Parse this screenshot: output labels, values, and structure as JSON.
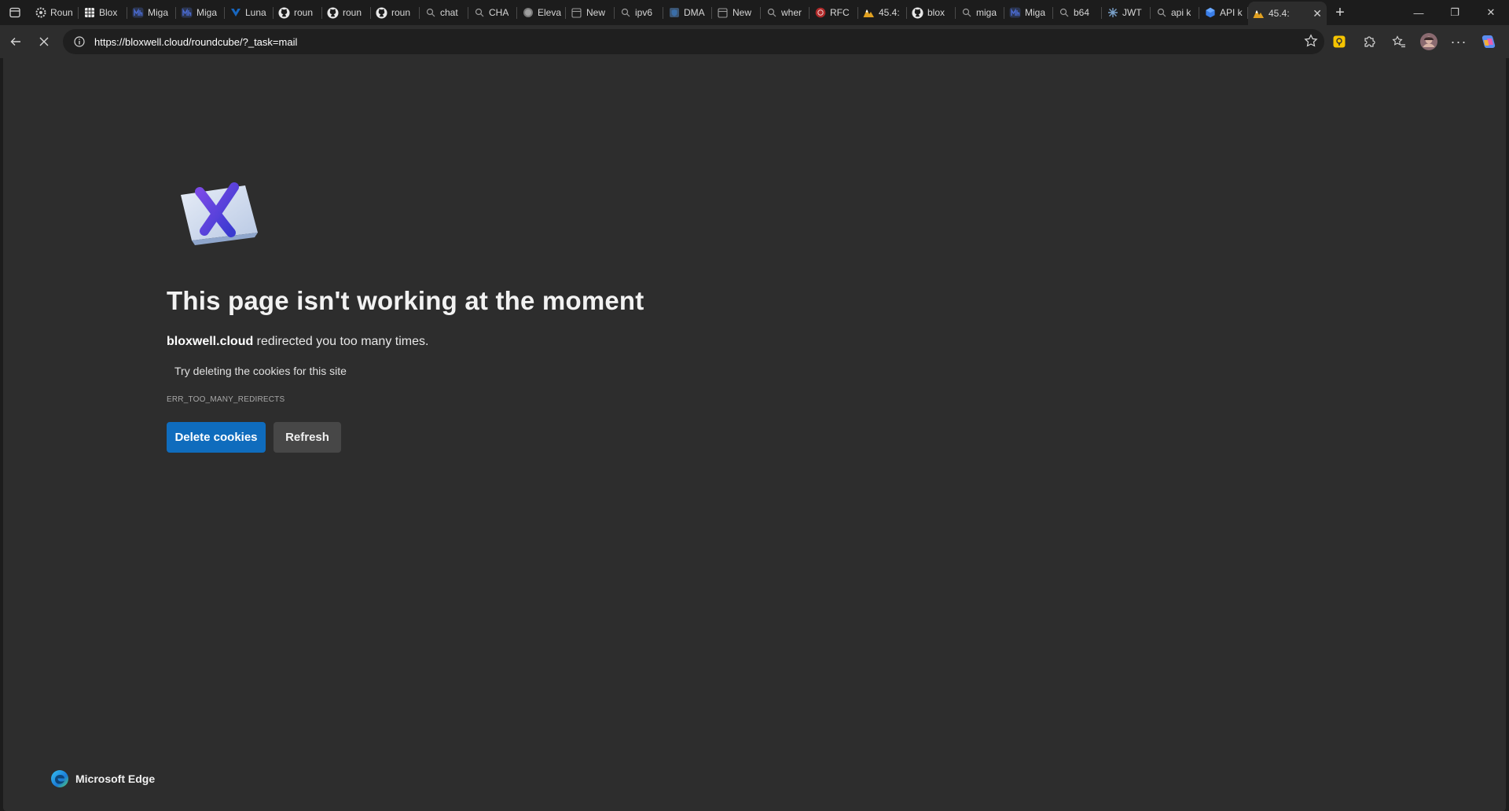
{
  "browser": {
    "tabs": [
      {
        "title": "Roun",
        "icon": "settings-gear-icon",
        "color": "#cfcfcf"
      },
      {
        "title": "Blox",
        "icon": "spreadsheet-icon",
        "color": "#e8e8e8"
      },
      {
        "title": "Miga",
        "icon": "mh-logo-icon",
        "color": "#4a6ad0"
      },
      {
        "title": "Miga",
        "icon": "mh-logo-icon",
        "color": "#4a6ad0"
      },
      {
        "title": "Luna",
        "icon": "vuetify-icon",
        "color": "#1867c0"
      },
      {
        "title": "roun",
        "icon": "github-icon",
        "color": "#e8e8e8"
      },
      {
        "title": "roun",
        "icon": "github-icon",
        "color": "#e8e8e8"
      },
      {
        "title": "roun",
        "icon": "github-icon",
        "color": "#e8e8e8"
      },
      {
        "title": "chat",
        "icon": "search-icon",
        "color": "#9a9a9a"
      },
      {
        "title": "CHA",
        "icon": "search-icon",
        "color": "#9a9a9a"
      },
      {
        "title": "Eleva",
        "icon": "circle-icon",
        "color": "#9a9a9a"
      },
      {
        "title": "New",
        "icon": "new-tab-icon",
        "color": "#9a9a9a"
      },
      {
        "title": "ipv6",
        "icon": "search-icon",
        "color": "#9a9a9a"
      },
      {
        "title": "DMA",
        "icon": "shield-icon",
        "color": "#3a6ea8"
      },
      {
        "title": "New",
        "icon": "new-tab-icon",
        "color": "#9a9a9a"
      },
      {
        "title": "wher",
        "icon": "search-icon",
        "color": "#9a9a9a"
      },
      {
        "title": "RFC",
        "icon": "rfc-icon",
        "color": "#b02a2a"
      },
      {
        "title": "45.4:",
        "icon": "mountain-icon",
        "color": "#e0a020"
      },
      {
        "title": "blox",
        "icon": "github-icon",
        "color": "#e8e8e8"
      },
      {
        "title": "miga",
        "icon": "search-icon",
        "color": "#9a9a9a"
      },
      {
        "title": "Miga",
        "icon": "mh-logo-icon",
        "color": "#4a6ad0"
      },
      {
        "title": "b64",
        "icon": "search-icon",
        "color": "#9a9a9a"
      },
      {
        "title": "JWT",
        "icon": "jwt-icon",
        "color": "#7aa0c8"
      },
      {
        "title": "api k",
        "icon": "search-icon",
        "color": "#9a9a9a"
      },
      {
        "title": "API k",
        "icon": "cube-icon",
        "color": "#3a7ee8"
      },
      {
        "title": "45.4:",
        "icon": "mountain-icon",
        "color": "#e0a020"
      }
    ],
    "url": "https://bloxwell.cloud/roundcube/?_task=mail"
  },
  "error_page": {
    "title": "This page isn't working at the moment",
    "domain": "bloxwell.cloud",
    "message": " redirected you too many times.",
    "suggestion": "Try deleting the cookies for this site",
    "code": "ERR_TOO_MANY_REDIRECTS",
    "primary_button": "Delete cookies",
    "secondary_button": "Refresh",
    "brand": "Microsoft Edge"
  },
  "colors": {
    "primary_button": "#0f6cbd",
    "page_background": "#2d2d2d"
  }
}
